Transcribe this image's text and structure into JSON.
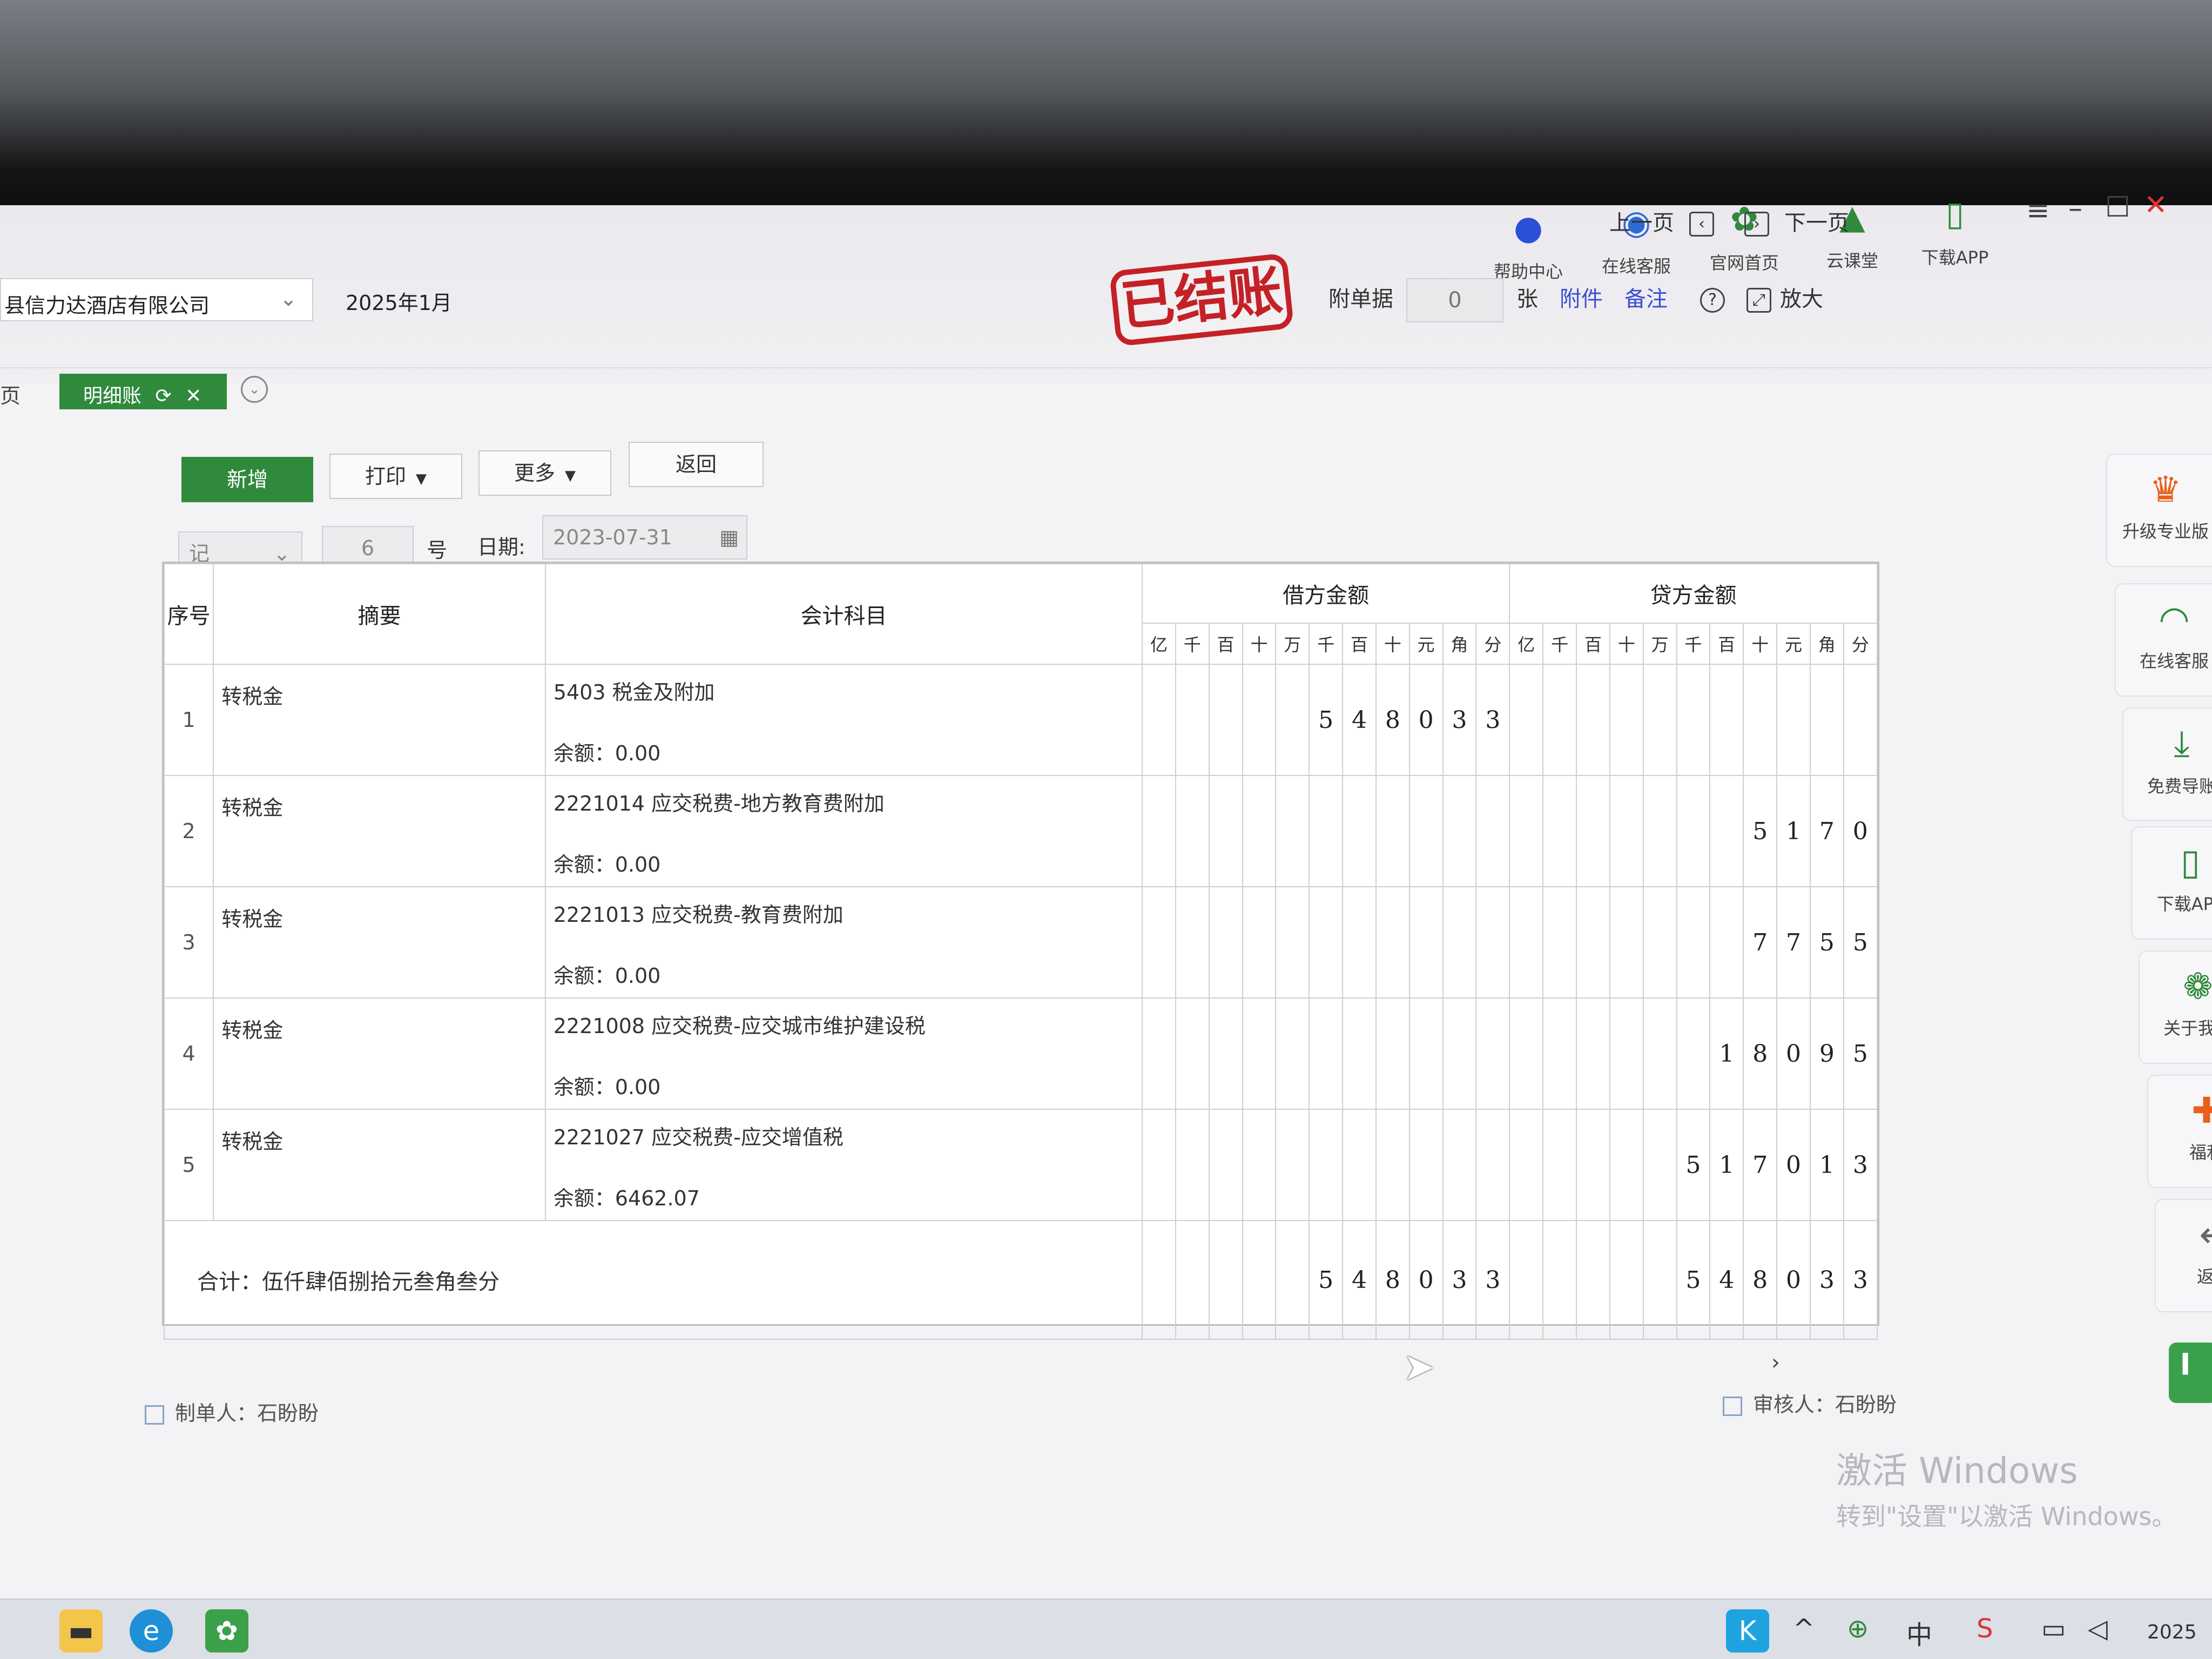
{
  "header": {
    "company": "县信力达酒店有限公司",
    "period": "2025年1月",
    "top_icons": [
      {
        "label": "帮助中心",
        "icon": "bulb-icon"
      },
      {
        "label": "在线客服",
        "icon": "headset-icon"
      },
      {
        "label": "官网首页",
        "icon": "home-logo-icon"
      },
      {
        "label": "云课堂",
        "icon": "graduation-cap-icon"
      },
      {
        "label": "下载APP",
        "icon": "phone-icon"
      }
    ]
  },
  "tabs": {
    "prev_label": "页",
    "active_label": "明细账",
    "refresh_glyph": "⟳",
    "close_glyph": "✕",
    "menu_glyph": "⌄"
  },
  "pager": {
    "prev": "上一页",
    "next": "下一页"
  },
  "toolbar": {
    "add": "新增",
    "print": "打印",
    "more": "更多",
    "back": "返回"
  },
  "voucher": {
    "type": "记",
    "number": "6",
    "number_suffix": "号",
    "date_label": "日期:",
    "date": "2023-07-31",
    "status_stamp": "已结账",
    "attach_label": "附单据",
    "attach_count": "0",
    "attach_unit": "张",
    "attachment_link": "附件",
    "note_link": "备注",
    "zoom_label": "放大"
  },
  "table": {
    "col_seq": "序号",
    "col_summary": "摘要",
    "col_account": "会计科目",
    "col_debit": "借方金额",
    "col_credit": "贷方金额",
    "units": [
      "亿",
      "千",
      "百",
      "十",
      "万",
      "千",
      "百",
      "十",
      "元",
      "角",
      "分"
    ],
    "balance_label": "余额：",
    "rows": [
      {
        "seq": "1",
        "summary": "转税金",
        "account": "5403 税金及附加",
        "balance": "0.00",
        "debit": "548033",
        "credit": ""
      },
      {
        "seq": "2",
        "summary": "转税金",
        "account": "2221014 应交税费-地方教育费附加",
        "balance": "0.00",
        "debit": "",
        "credit": "5170"
      },
      {
        "seq": "3",
        "summary": "转税金",
        "account": "2221013 应交税费-教育费附加",
        "balance": "0.00",
        "debit": "",
        "credit": "7755"
      },
      {
        "seq": "4",
        "summary": "转税金",
        "account": "2221008 应交税费-应交城市维护建设税",
        "balance": "0.00",
        "debit": "",
        "credit": "18095"
      },
      {
        "seq": "5",
        "summary": "转税金",
        "account": "2221027 应交税费-应交增值税",
        "balance": "6462.07",
        "debit": "",
        "credit": "517013"
      }
    ],
    "total_label": "合计：伍仟肆佰捌拾元叁角叁分",
    "total_debit": "548033",
    "total_credit": "548033"
  },
  "footer": {
    "maker": "制单人：石盼盼",
    "reviewer": "审核人：石盼盼"
  },
  "right_sidebar": [
    {
      "label": "升级专业版",
      "icon": "crown-icon"
    },
    {
      "label": "在线客服",
      "icon": "headset-icon"
    },
    {
      "label": "免费导账",
      "icon": "download-icon"
    },
    {
      "label": "下载APP",
      "icon": "phone-icon"
    },
    {
      "label": "关于我们",
      "icon": "wechat-icon"
    },
    {
      "label": "福利",
      "icon": "gift-icon"
    },
    {
      "label": "返回",
      "icon": "back-icon"
    }
  ],
  "watermark": {
    "line1": "激活 Windows",
    "line2": "转到\"设置\"以激活 Windows。"
  },
  "taskbar": {
    "ime": "中",
    "clock": "2025"
  },
  "colors": {
    "accent_green": "#2f8a3c",
    "stamp_red": "#c42127",
    "link_blue": "#3b4fd0"
  }
}
